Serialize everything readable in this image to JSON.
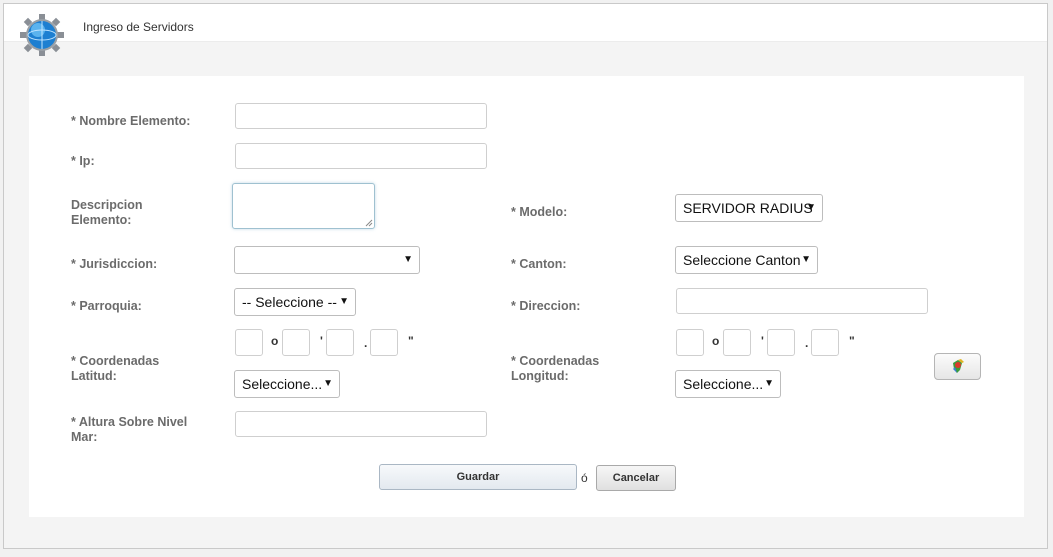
{
  "header": {
    "title": "Ingreso de Servidors"
  },
  "form": {
    "nombre_label": "* Nombre Elemento:",
    "ip_label": "* Ip:",
    "descripcion_label": "Descripcion Elemento:",
    "modelo_label": "* Modelo:",
    "modelo_value": "SERVIDOR RADIUS",
    "jurisdiccion_label": "* Jurisdiccion:",
    "jurisdiccion_value": "",
    "canton_label": "* Canton:",
    "canton_value": "Seleccione Canton",
    "parroquia_label": "* Parroquia:",
    "parroquia_value": "-- Seleccione --",
    "direccion_label": "* Direccion:",
    "latitud_label": "* Coordenadas Latitud:",
    "latitud_select": "Seleccione...",
    "longitud_label": "* Coordenadas Longitud:",
    "longitud_select": "Seleccione...",
    "altura_label": "* Altura Sobre Nivel Mar:",
    "deg_symbol": "o",
    "min_symbol": "'",
    "dot_symbol": ".",
    "sec_symbol": "\""
  },
  "actions": {
    "save_label": "Guardar",
    "or_label": "ó",
    "cancel_label": "Cancelar"
  },
  "icons": {
    "logo": "globe-gear-icon",
    "map": "map-location-icon",
    "caret": "▼"
  }
}
